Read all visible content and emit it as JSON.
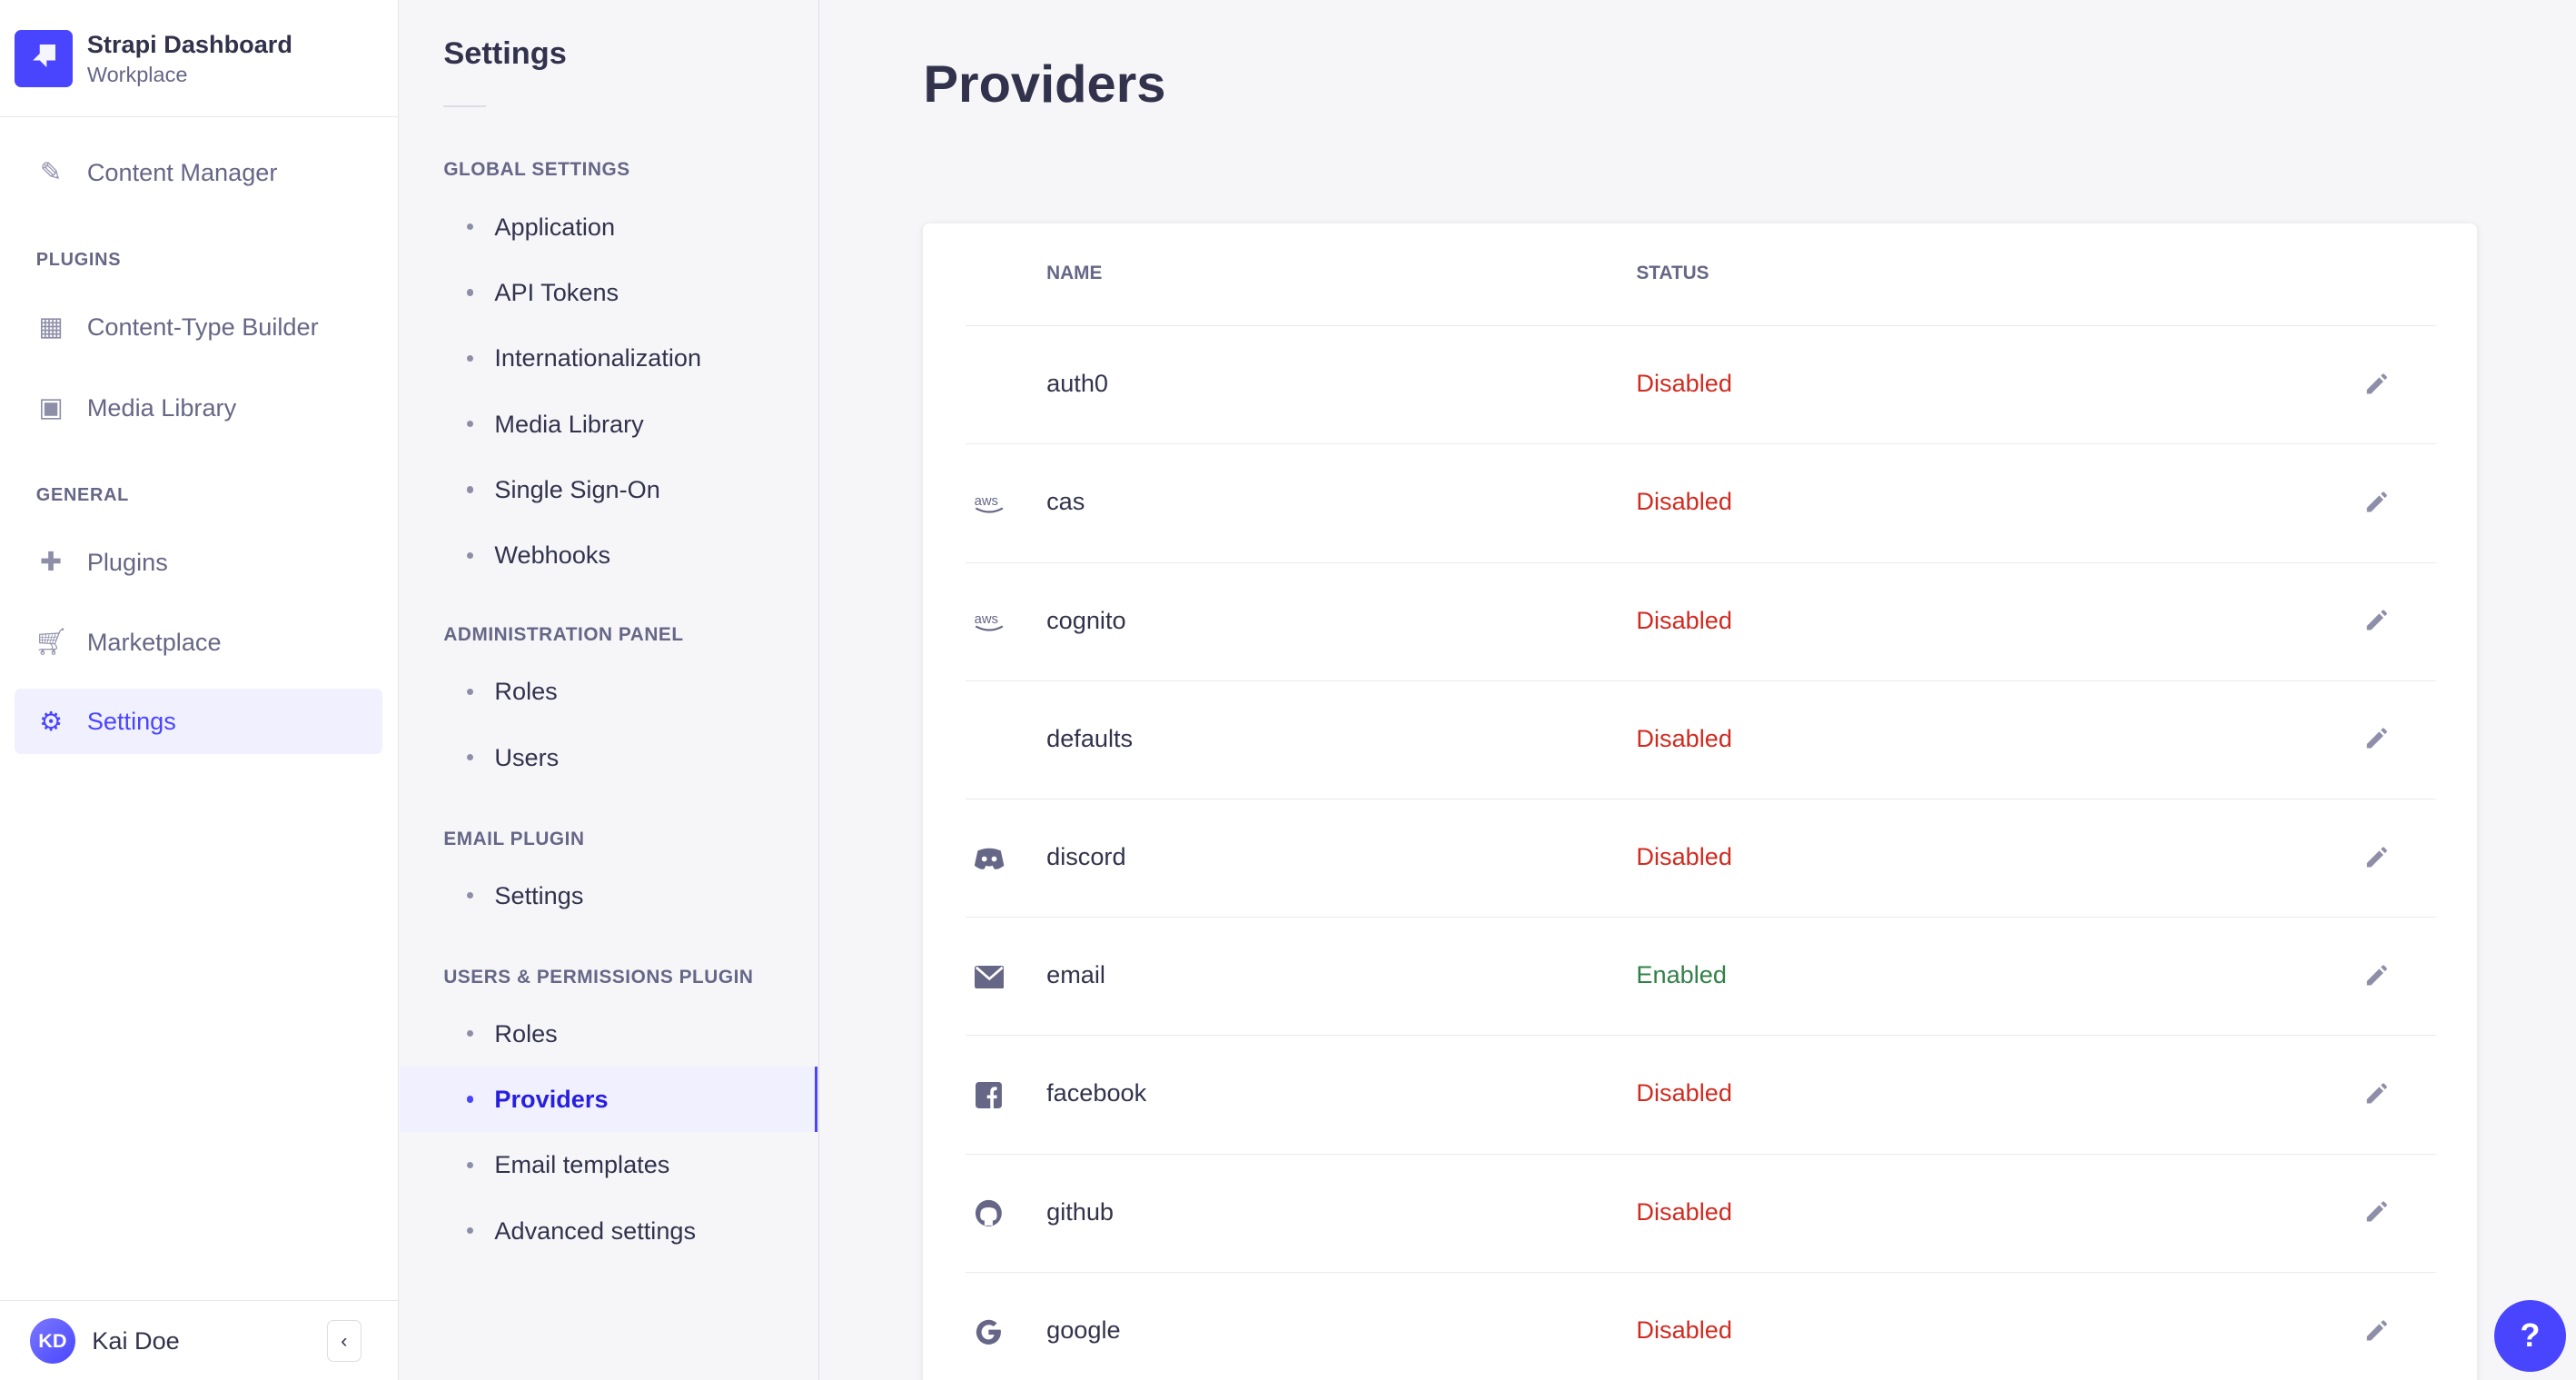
{
  "brand": {
    "title": "Strapi Dashboard",
    "subtitle": "Workplace"
  },
  "nav": {
    "content_manager": "Content Manager",
    "plugins_section": "PLUGINS",
    "content_type_builder": "Content-Type Builder",
    "media_library": "Media Library",
    "general_section": "GENERAL",
    "plugins": "Plugins",
    "marketplace": "Marketplace",
    "settings": "Settings"
  },
  "user": {
    "initials": "KD",
    "name": "Kai Doe"
  },
  "settings_nav": {
    "title": "Settings",
    "sections": [
      {
        "label": "GLOBAL SETTINGS",
        "items": [
          "Application",
          "API Tokens",
          "Internationalization",
          "Media Library",
          "Single Sign-On",
          "Webhooks"
        ]
      },
      {
        "label": "ADMINISTRATION PANEL",
        "items": [
          "Roles",
          "Users"
        ]
      },
      {
        "label": "EMAIL PLUGIN",
        "items": [
          "Settings"
        ]
      },
      {
        "label": "USERS & PERMISSIONS PLUGIN",
        "items": [
          "Roles",
          "Providers",
          "Email templates",
          "Advanced settings"
        ]
      }
    ],
    "active": "Providers"
  },
  "page": {
    "title": "Providers"
  },
  "table": {
    "headers": {
      "name": "NAME",
      "status": "STATUS"
    },
    "rows": [
      {
        "icon": "none",
        "name": "auth0",
        "status": "Disabled"
      },
      {
        "icon": "aws-icon",
        "name": "cas",
        "status": "Disabled"
      },
      {
        "icon": "aws-icon",
        "name": "cognito",
        "status": "Disabled"
      },
      {
        "icon": "none",
        "name": "defaults",
        "status": "Disabled"
      },
      {
        "icon": "discord-icon",
        "name": "discord",
        "status": "Disabled"
      },
      {
        "icon": "mail-icon",
        "name": "email",
        "status": "Enabled"
      },
      {
        "icon": "facebook-icon",
        "name": "facebook",
        "status": "Disabled"
      },
      {
        "icon": "github-icon",
        "name": "github",
        "status": "Disabled"
      },
      {
        "icon": "google-icon",
        "name": "google",
        "status": "Disabled"
      }
    ]
  },
  "colors": {
    "accent": "#4945ff",
    "disabled": "#d02b20",
    "enabled": "#328048"
  },
  "help": "?"
}
